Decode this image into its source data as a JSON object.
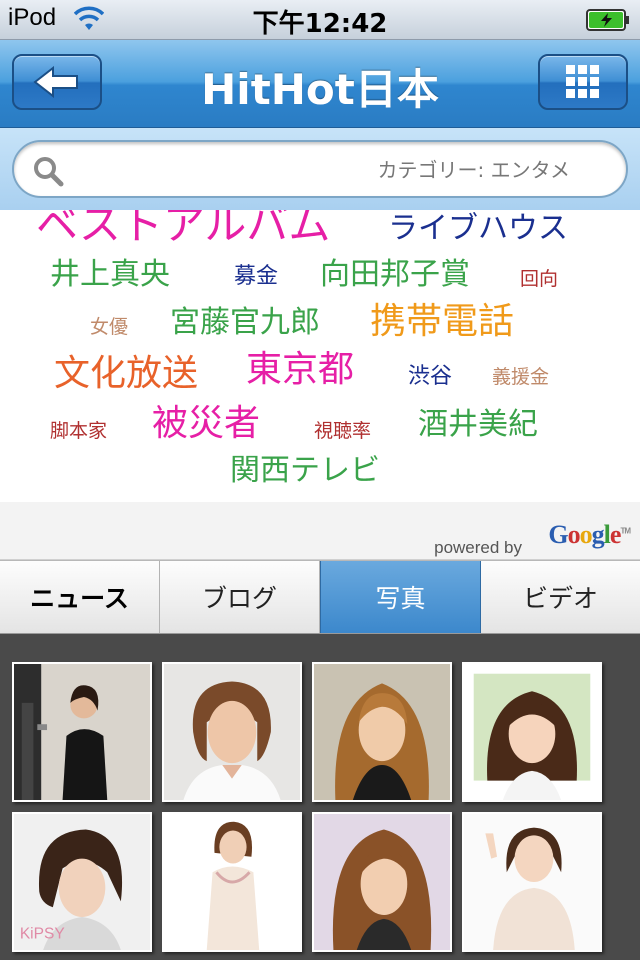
{
  "status_bar": {
    "carrier": "iPod",
    "time": "下午12:42"
  },
  "nav": {
    "title": "HitHot日本",
    "back_icon": "left-arrow-icon",
    "menu_icon": "grid-icon"
  },
  "search": {
    "placeholder": "カテゴリー: エンタメ"
  },
  "tag_cloud": {
    "tags": [
      {
        "text": "ベストアルバム",
        "color": "#e61fa6"
      },
      {
        "text": "ライブハウス",
        "color": "#1a2f8f"
      },
      {
        "text": "井上真央",
        "color": "#3aa34a"
      },
      {
        "text": "募金",
        "color": "#1a2f8f"
      },
      {
        "text": "向田邦子賞",
        "color": "#3aa34a"
      },
      {
        "text": "回向",
        "color": "#b03030"
      },
      {
        "text": "女優",
        "color": "#c08a6a"
      },
      {
        "text": "宮藤官九郎",
        "color": "#3aa34a"
      },
      {
        "text": "携帯電話",
        "color": "#f09a1a"
      },
      {
        "text": "文化放送",
        "color": "#e8622a"
      },
      {
        "text": "東京都",
        "color": "#e61fa6"
      },
      {
        "text": "渋谷",
        "color": "#1a2f8f"
      },
      {
        "text": "義援金",
        "color": "#c08a6a"
      },
      {
        "text": "脚本家",
        "color": "#b03030"
      },
      {
        "text": "被災者",
        "color": "#e61fa6"
      },
      {
        "text": "視聴率",
        "color": "#b03030"
      },
      {
        "text": "酒井美紀",
        "color": "#3aa34a"
      },
      {
        "text": "関西テレビ",
        "color": "#3aa34a"
      }
    ]
  },
  "attribution": {
    "powered_by": "powered by",
    "google_letters": [
      "G",
      "o",
      "o",
      "g",
      "l",
      "e"
    ],
    "trademark": "TM"
  },
  "tabs": [
    {
      "label": "ニュース",
      "selected": false
    },
    {
      "label": "ブログ",
      "selected": false
    },
    {
      "label": "写真",
      "selected": true
    },
    {
      "label": "ビデオ",
      "selected": false
    }
  ],
  "photos": {
    "count": 8,
    "thumb_watermark": "KiPSY"
  },
  "colors": {
    "nav_blue": "#2f86cf",
    "active_tab": "#3c88cc",
    "photo_bg": "#4a4a4a"
  }
}
